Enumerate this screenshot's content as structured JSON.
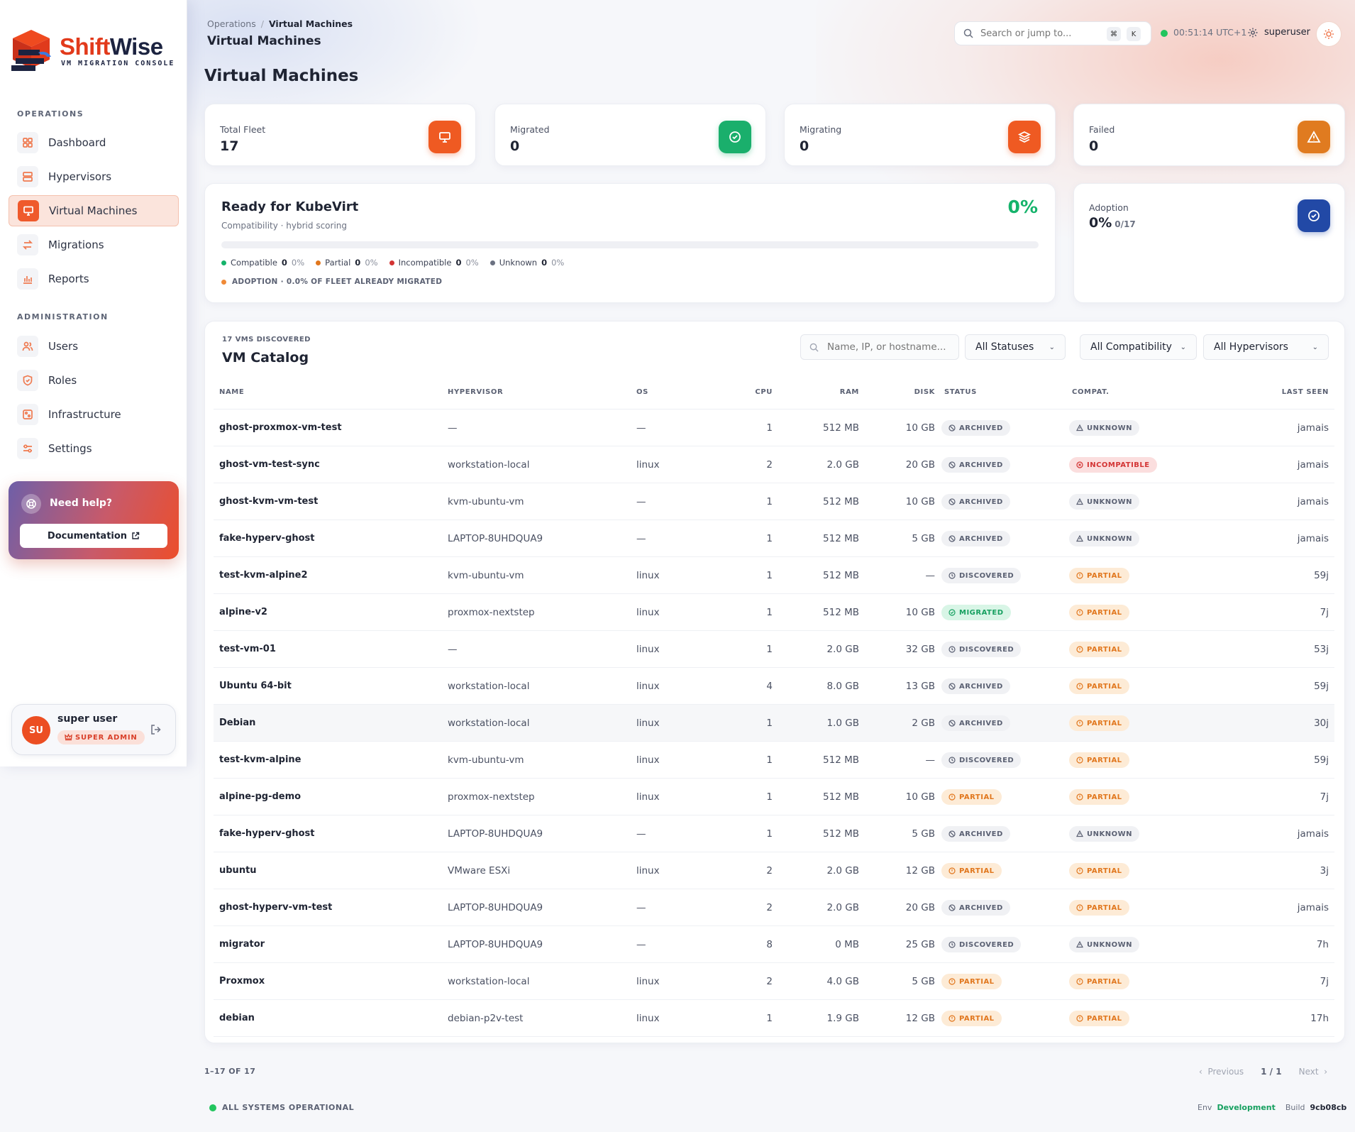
{
  "app": {
    "name_a": "Shift",
    "name_b": "Wise",
    "subtitle": "VM MIGRATION CONSOLE"
  },
  "colors": {
    "accent": "#ec4e22",
    "success": "#15b36b",
    "blue": "#2249a6"
  },
  "sidebar": {
    "sections": [
      {
        "title": "OPERATIONS"
      },
      {
        "title": "ADMINISTRATION"
      }
    ],
    "items": [
      {
        "label": "Dashboard",
        "icon": "grid-icon"
      },
      {
        "label": "Hypervisors",
        "icon": "server-icon"
      },
      {
        "label": "Virtual Machines",
        "icon": "monitor-icon",
        "active": true
      },
      {
        "label": "Migrations",
        "icon": "arrows-icon"
      },
      {
        "label": "Reports",
        "icon": "bar-chart-icon"
      },
      {
        "label": "Users",
        "icon": "users-icon"
      },
      {
        "label": "Roles",
        "icon": "shield-icon"
      },
      {
        "label": "Infrastructure",
        "icon": "infra-icon"
      },
      {
        "label": "Settings",
        "icon": "sliders-icon"
      }
    ],
    "help": {
      "title": "Need help?",
      "button": "Documentation"
    },
    "user": {
      "initials": "SU",
      "name": "super user",
      "role": "SUPER ADMIN"
    }
  },
  "header": {
    "breadcrumb": [
      "Operations",
      "Virtual Machines"
    ],
    "title": "Virtual Machines",
    "search_placeholder": "Search or jump to...",
    "kbd": [
      "⌘",
      "K"
    ],
    "clock": "00:51:14",
    "tz": "UTC+1",
    "user": "superuser"
  },
  "page_title": "Virtual Machines",
  "stats": [
    {
      "label": "Total Fleet",
      "value": "17",
      "icon": "monitor-icon",
      "color": "#ef5a22"
    },
    {
      "label": "Migrated",
      "value": "0",
      "icon": "check-circle-icon",
      "color": "#1aaf6c"
    },
    {
      "label": "Migrating",
      "value": "0",
      "icon": "layers-icon",
      "color": "#ef5a22"
    },
    {
      "label": "Failed",
      "value": "0",
      "icon": "warning-icon",
      "color": "#e07b20"
    }
  ],
  "kubevirt": {
    "title": "Ready for KubeVirt",
    "subtitle": "Compatibility · hybrid scoring",
    "percent": "0%",
    "progress": 0,
    "legend": [
      {
        "label": "Compatible",
        "count": "0",
        "pct": "0%",
        "color": "#15b36b"
      },
      {
        "label": "Partial",
        "count": "0",
        "pct": "0%",
        "color": "#e1771e"
      },
      {
        "label": "Incompatible",
        "count": "0",
        "pct": "0%",
        "color": "#d33434"
      },
      {
        "label": "Unknown",
        "count": "0",
        "pct": "0%",
        "color": "#6b7181"
      }
    ],
    "note": "ADOPTION · 0.0% OF FLEET ALREADY MIGRATED"
  },
  "adoption": {
    "label": "Adoption",
    "value": "0%",
    "fraction": "0/17"
  },
  "catalog": {
    "count": "17 VMS DISCOVERED",
    "title": "VM Catalog",
    "search_placeholder": "Name, IP, or hostname...",
    "filters": [
      "All Statuses",
      "All Compatibility",
      "All Hypervisors"
    ],
    "columns": [
      "NAME",
      "HYPERVISOR",
      "OS",
      "CPU",
      "RAM",
      "DISK",
      "STATUS",
      "COMPAT.",
      "LAST SEEN"
    ],
    "rows": [
      {
        "name": "ghost-proxmox-vm-test",
        "hypervisor": "—",
        "os": "—",
        "cpu": "1",
        "ram": "512 MB",
        "disk": "10 GB",
        "status": "ARCHIVED",
        "compat": "UNKNOWN",
        "seen": "jamais"
      },
      {
        "name": "ghost-vm-test-sync",
        "hypervisor": "workstation-local",
        "os": "linux",
        "cpu": "2",
        "ram": "2.0 GB",
        "disk": "20 GB",
        "status": "ARCHIVED",
        "compat": "INCOMPATIBLE",
        "seen": "jamais"
      },
      {
        "name": "ghost-kvm-vm-test",
        "hypervisor": "kvm-ubuntu-vm",
        "os": "—",
        "cpu": "1",
        "ram": "512 MB",
        "disk": "10 GB",
        "status": "ARCHIVED",
        "compat": "UNKNOWN",
        "seen": "jamais"
      },
      {
        "name": "fake-hyperv-ghost",
        "hypervisor": "LAPTOP-8UHDQUA9",
        "os": "—",
        "cpu": "1",
        "ram": "512 MB",
        "disk": "5 GB",
        "status": "ARCHIVED",
        "compat": "UNKNOWN",
        "seen": "jamais"
      },
      {
        "name": "test-kvm-alpine2",
        "hypervisor": "kvm-ubuntu-vm",
        "os": "linux",
        "cpu": "1",
        "ram": "512 MB",
        "disk": "—",
        "status": "DISCOVERED",
        "compat": "PARTIAL",
        "seen": "59j"
      },
      {
        "name": "alpine-v2",
        "hypervisor": "proxmox-nextstep",
        "os": "linux",
        "cpu": "1",
        "ram": "512 MB",
        "disk": "10 GB",
        "status": "MIGRATED",
        "compat": "PARTIAL",
        "seen": "7j"
      },
      {
        "name": "test-vm-01",
        "hypervisor": "—",
        "os": "linux",
        "cpu": "1",
        "ram": "2.0 GB",
        "disk": "32 GB",
        "status": "DISCOVERED",
        "compat": "PARTIAL",
        "seen": "53j"
      },
      {
        "name": "Ubuntu 64-bit",
        "hypervisor": "workstation-local",
        "os": "linux",
        "cpu": "4",
        "ram": "8.0 GB",
        "disk": "13 GB",
        "status": "ARCHIVED",
        "compat": "PARTIAL",
        "seen": "59j"
      },
      {
        "name": "Debian",
        "hypervisor": "workstation-local",
        "os": "linux",
        "cpu": "1",
        "ram": "1.0 GB",
        "disk": "2 GB",
        "status": "ARCHIVED",
        "compat": "PARTIAL",
        "seen": "30j"
      },
      {
        "name": "test-kvm-alpine",
        "hypervisor": "kvm-ubuntu-vm",
        "os": "linux",
        "cpu": "1",
        "ram": "512 MB",
        "disk": "—",
        "status": "DISCOVERED",
        "compat": "PARTIAL",
        "seen": "59j"
      },
      {
        "name": "alpine-pg-demo",
        "hypervisor": "proxmox-nextstep",
        "os": "linux",
        "cpu": "1",
        "ram": "512 MB",
        "disk": "10 GB",
        "status": "PARTIAL",
        "compat": "PARTIAL",
        "seen": "7j"
      },
      {
        "name": "fake-hyperv-ghost",
        "hypervisor": "LAPTOP-8UHDQUA9",
        "os": "—",
        "cpu": "1",
        "ram": "512 MB",
        "disk": "5 GB",
        "status": "ARCHIVED",
        "compat": "UNKNOWN",
        "seen": "jamais"
      },
      {
        "name": "ubuntu",
        "hypervisor": "VMware ESXi",
        "os": "linux",
        "cpu": "2",
        "ram": "2.0 GB",
        "disk": "12 GB",
        "status": "PARTIAL",
        "compat": "PARTIAL",
        "seen": "3j"
      },
      {
        "name": "ghost-hyperv-vm-test",
        "hypervisor": "LAPTOP-8UHDQUA9",
        "os": "—",
        "cpu": "2",
        "ram": "2.0 GB",
        "disk": "20 GB",
        "status": "ARCHIVED",
        "compat": "PARTIAL",
        "seen": "jamais"
      },
      {
        "name": "migrator",
        "hypervisor": "LAPTOP-8UHDQUA9",
        "os": "—",
        "cpu": "8",
        "ram": "0 MB",
        "disk": "25 GB",
        "status": "DISCOVERED",
        "compat": "UNKNOWN",
        "seen": "7h"
      },
      {
        "name": "Proxmox",
        "hypervisor": "workstation-local",
        "os": "linux",
        "cpu": "2",
        "ram": "4.0 GB",
        "disk": "5 GB",
        "status": "PARTIAL",
        "compat": "PARTIAL",
        "seen": "7j"
      },
      {
        "name": "debian",
        "hypervisor": "debian-p2v-test",
        "os": "linux",
        "cpu": "1",
        "ram": "1.9 GB",
        "disk": "12 GB",
        "status": "PARTIAL",
        "compat": "PARTIAL",
        "seen": "17h"
      }
    ]
  },
  "pagination": {
    "info": "1–17 OF 17",
    "prev": "Previous",
    "page": "1 / 1",
    "next": "Next"
  },
  "footer": {
    "status": "ALL SYSTEMS OPERATIONAL",
    "env_label": "Env",
    "env": "Development",
    "build_label": "Build",
    "build": "9cb08cb"
  }
}
